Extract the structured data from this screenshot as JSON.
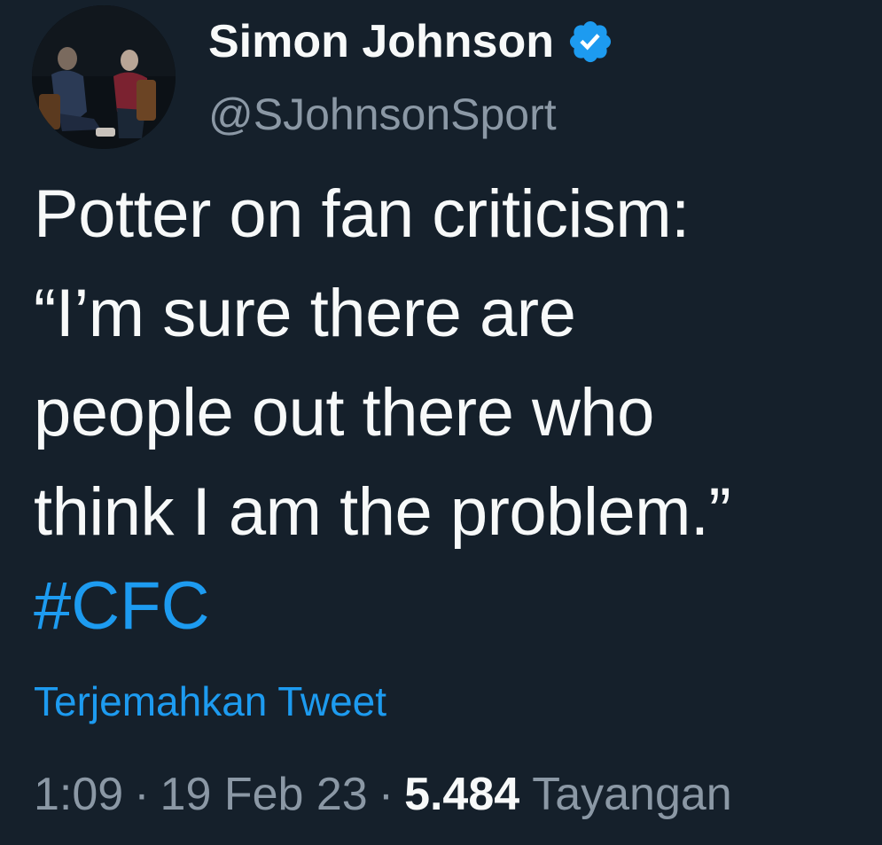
{
  "author": {
    "display_name": "Simon Johnson",
    "handle": "@SJohnsonSport",
    "verified": true,
    "avatar_icon": "profile-photo"
  },
  "tweet": {
    "text": "Potter on fan criticism:\n“I’m sure there are\npeople out there who\nthink I am the problem.”",
    "hashtag": "#CFC",
    "translate_label": "Terjemahkan Tweet"
  },
  "meta": {
    "time": "1:09",
    "separator": "·",
    "date": "19 Feb 23",
    "views_count": "5.484",
    "views_label": "Tayangan"
  },
  "colors": {
    "background": "#15202b",
    "text_primary": "#f7f9f9",
    "text_secondary": "#8b98a5",
    "accent": "#1d9bf0"
  }
}
